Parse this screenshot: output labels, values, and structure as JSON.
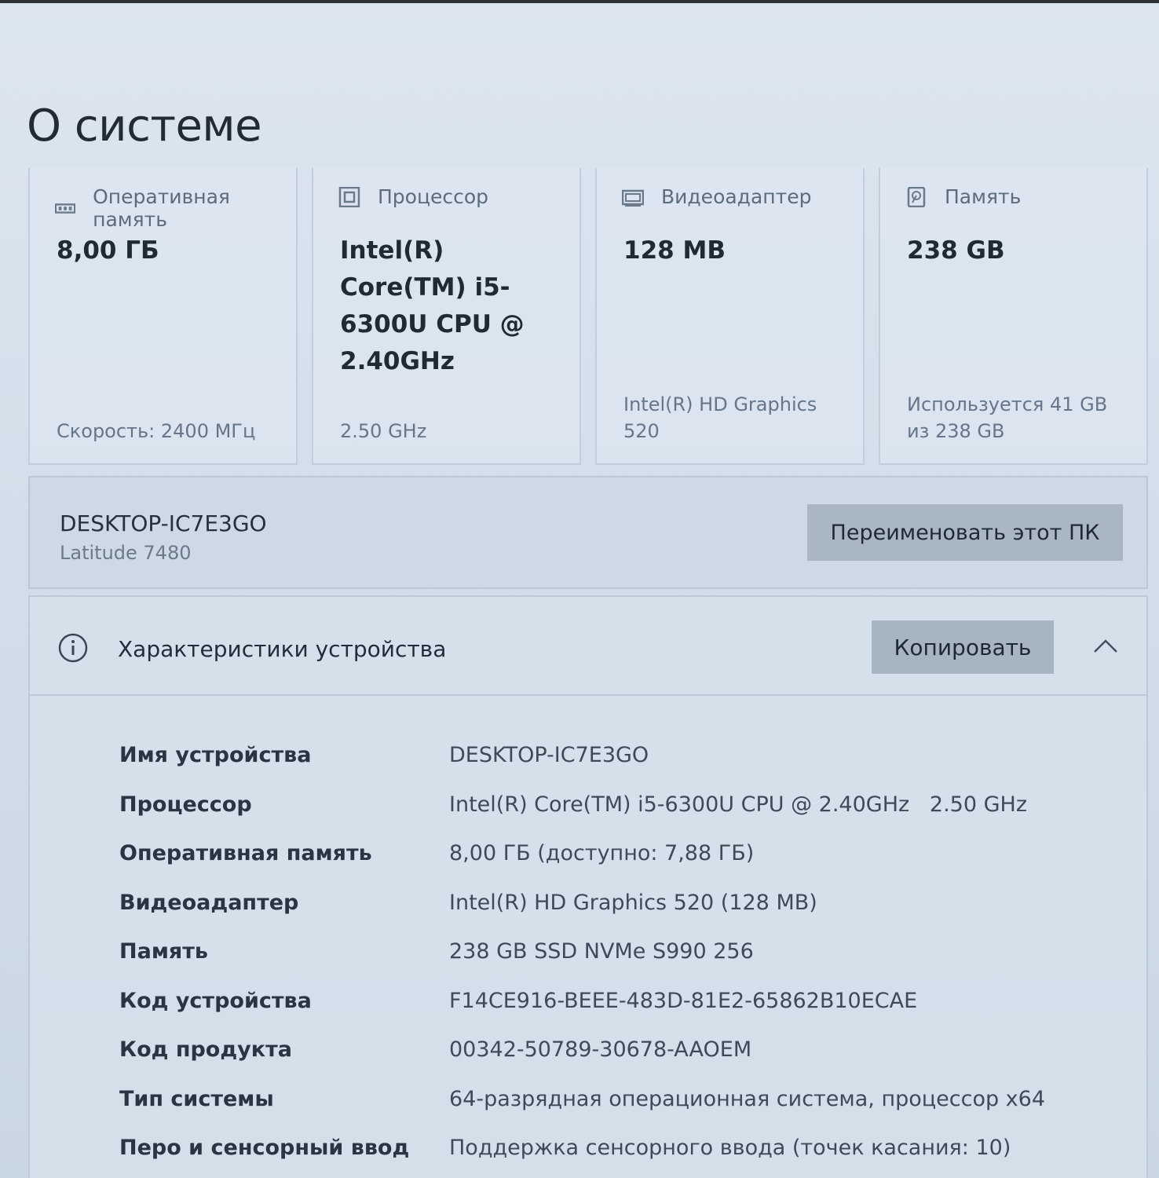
{
  "page": {
    "title": "О системе"
  },
  "cards": [
    {
      "icon": "ram-icon",
      "label": "Оперативная память",
      "value": "8,00 ГБ",
      "foot": "Скорость: 2400 МГц"
    },
    {
      "icon": "processor-icon",
      "label": "Процессор",
      "value": "Intel(R) Core(TM) i5-6300U CPU @ 2.40GHz",
      "foot": "2.50 GHz"
    },
    {
      "icon": "video-adapter-icon",
      "label": "Видеоадаптер",
      "value": "128 MB",
      "foot": "Intel(R) HD Graphics 520"
    },
    {
      "icon": "storage-icon",
      "label": "Память",
      "value": "238 GB",
      "foot": "Используется 41 GB из 238 GB"
    }
  ],
  "device": {
    "name": "DESKTOP-IC7E3GO",
    "model": "Latitude 7480",
    "rename_label": "Переименовать этот ПК"
  },
  "specs": {
    "title": "Характеристики устройства",
    "copy_label": "Копировать",
    "rows": [
      {
        "label": "Имя устройства",
        "value": "DESKTOP-IC7E3GO"
      },
      {
        "label": "Процессор",
        "value": "Intel(R) Core(TM) i5-6300U CPU @ 2.40GHz   2.50 GHz"
      },
      {
        "label": "Оперативная память",
        "value": "8,00 ГБ (доступно: 7,88 ГБ)"
      },
      {
        "label": "Видеоадаптер",
        "value": "Intel(R) HD Graphics 520 (128 MB)"
      },
      {
        "label": "Память",
        "value": "238 GB SSD NVMe S990 256"
      },
      {
        "label": "Код устройства",
        "value": "F14CE916-BEEE-483D-81E2-65862B10ECAE"
      },
      {
        "label": "Код продукта",
        "value": "00342-50789-30678-AAOEM"
      },
      {
        "label": "Тип системы",
        "value": "64-разрядная операционная система, процессор x64"
      },
      {
        "label": "Перо и сенсорный ввод",
        "value": "Поддержка сенсорного ввода (точек касания: 10)"
      }
    ]
  }
}
